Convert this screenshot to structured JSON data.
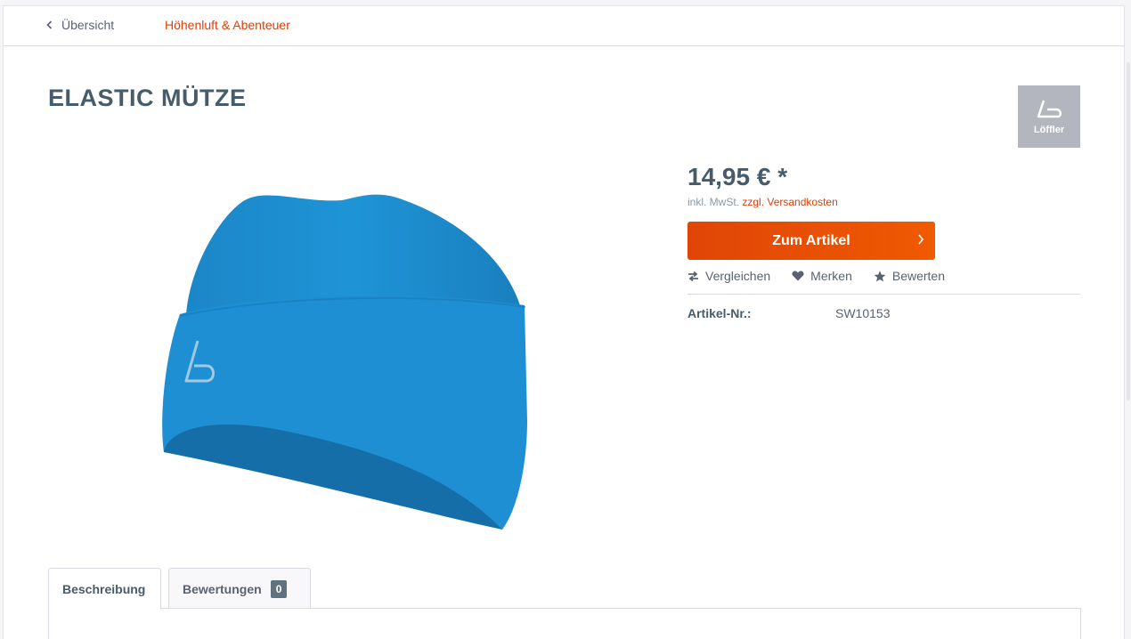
{
  "breadcrumb": {
    "back_label": "Übersicht",
    "category_label": "Höhenluft & Abenteuer"
  },
  "product": {
    "title": "ELASTIC MÜTZE",
    "brand_logo_text": "Löffler",
    "image_color": "#1a8fd0",
    "price": "14,95 € *",
    "tax_note": "inkl. MwSt.",
    "shipping_link": "zzgl. Versandkosten",
    "buy_button_label": "Zum Artikel",
    "actions": {
      "compare": "Vergleichen",
      "remember": "Merken",
      "rate": "Bewerten"
    },
    "specs": {
      "article_no_label": "Artikel-Nr.:",
      "article_no_value": "SW10153"
    }
  },
  "tabs": [
    {
      "label": "Beschreibung"
    },
    {
      "label": "Bewertungen",
      "badge": "0"
    }
  ],
  "colors": {
    "accent": "#d9400b",
    "button": "#f05a00",
    "heading": "#475c6a"
  }
}
